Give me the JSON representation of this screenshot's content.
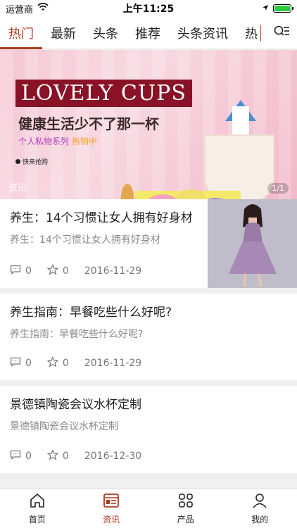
{
  "status_bar": {
    "carrier": "运营商",
    "time": "上午11:25"
  },
  "tabs": [
    {
      "label": "热门",
      "active": true
    },
    {
      "label": "最新",
      "active": false
    },
    {
      "label": "头条",
      "active": false
    },
    {
      "label": "推荐",
      "active": false
    },
    {
      "label": "头条资讯",
      "active": false
    },
    {
      "label": "热",
      "active": false
    }
  ],
  "banner": {
    "title": "LOVELY CUPS",
    "subtitle": "健康生活少不了那一杯",
    "small_text": "个人私物系列",
    "hot_text": "热销中",
    "tag": "快来抢购",
    "caption": "资讯",
    "page_indicator": "1/1"
  },
  "articles": [
    {
      "title": "养生：14个习惯让女人拥有好身材",
      "summary": "养生：14个习惯让女人拥有好身材",
      "comments": "0",
      "likes": "0",
      "date": "2016-11-29",
      "has_thumb": true
    },
    {
      "title": "养生指南：早餐吃些什么好呢?",
      "summary": "养生指南：早餐吃些什么好呢?",
      "comments": "0",
      "likes": "0",
      "date": "2016-11-29",
      "has_thumb": false
    },
    {
      "title": "景德镇陶瓷会议水杯定制",
      "summary": "景德镇陶瓷会议水杯定制",
      "comments": "0",
      "likes": "0",
      "date": "2016-12-30",
      "has_thumb": false
    }
  ],
  "bottom_nav": [
    {
      "label": "首页",
      "icon": "home-icon",
      "active": false
    },
    {
      "label": "资讯",
      "icon": "news-icon",
      "active": true
    },
    {
      "label": "产品",
      "icon": "grid-icon",
      "active": false
    },
    {
      "label": "我的",
      "icon": "user-icon",
      "active": false
    }
  ],
  "colors": {
    "accent": "#b03a20",
    "battery": "#2ecc40"
  }
}
